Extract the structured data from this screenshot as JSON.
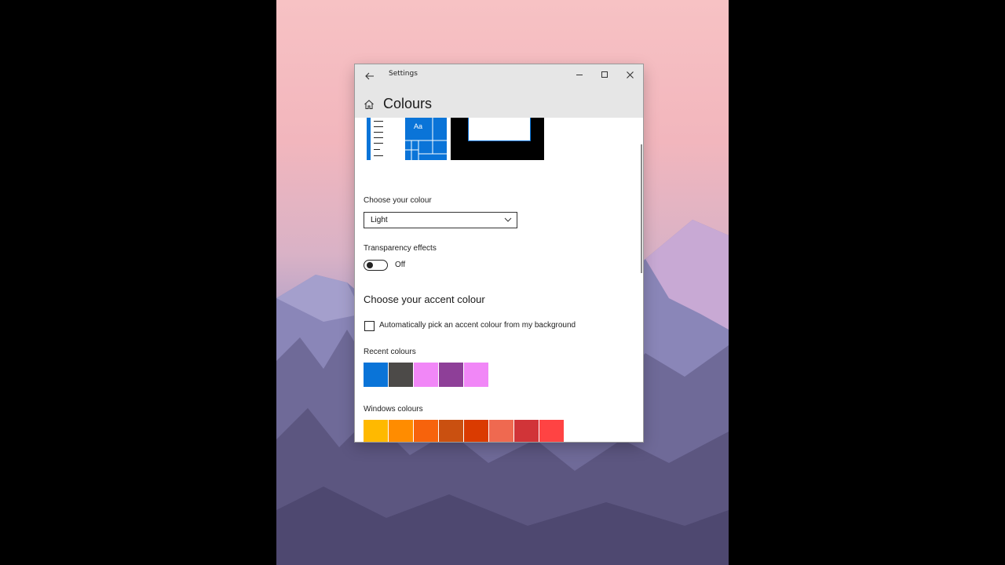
{
  "window": {
    "title": "Settings",
    "page_title": "Colours"
  },
  "preview": {
    "tile_text": "Aa"
  },
  "colour_mode": {
    "label": "Choose your colour",
    "selected": "Light"
  },
  "transparency": {
    "label": "Transparency effects",
    "state": "Off"
  },
  "accent": {
    "section_title": "Choose your accent colour",
    "auto_pick_label": "Automatically pick an accent colour from my background",
    "recent_label": "Recent colours",
    "recent_colours": [
      "#0a74d8",
      "#4c4a48",
      "#f187f7",
      "#8e3f98",
      "#f187f7"
    ],
    "windows_label": "Windows colours",
    "windows_colours": [
      "#ffb900",
      "#ff8c00",
      "#f7630c",
      "#ca5010",
      "#da3b01",
      "#ef6950",
      "#d13438",
      "#ff4343"
    ]
  }
}
